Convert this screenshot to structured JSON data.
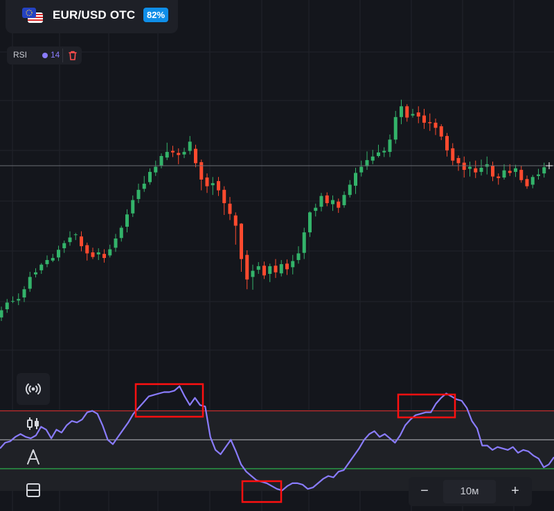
{
  "asset": {
    "name": "EUR/USD OTC",
    "payout": "82%"
  },
  "indicator": {
    "name": "RSI",
    "period": "14",
    "color": "#8a7cff"
  },
  "tools": [
    "signals-icon",
    "candles-icon",
    "drawing-tools-icon",
    "layout-icon"
  ],
  "zoom": {
    "minus": "−",
    "timeframe": "10м",
    "plus": "+"
  },
  "colors": {
    "bull": "#33b36a",
    "bear": "#ff4a2e",
    "rsi_line": "#8a7cff",
    "overbought": "#e02a2a",
    "oversold": "#2fd457",
    "highlight": "#ff1010"
  },
  "chart_data": [
    {
      "type": "candlestick",
      "title": "",
      "candles": [
        [
          0.3,
          0.44,
          0.23,
          0.51
        ],
        [
          0.46,
          0.59,
          0.39,
          0.66
        ],
        [
          0.61,
          0.62,
          0.58,
          0.71
        ],
        [
          0.63,
          0.66,
          0.54,
          0.77
        ],
        [
          0.69,
          0.85,
          0.6,
          0.91
        ],
        [
          0.86,
          1.09,
          0.8,
          1.19
        ],
        [
          1.14,
          1.18,
          1.08,
          1.26
        ],
        [
          1.22,
          1.33,
          1.15,
          1.36
        ],
        [
          1.34,
          1.42,
          1.28,
          1.51
        ],
        [
          1.41,
          1.46,
          1.38,
          1.54
        ],
        [
          1.47,
          1.62,
          1.4,
          1.7
        ],
        [
          1.65,
          1.75,
          1.56,
          1.8
        ],
        [
          1.77,
          1.86,
          1.7,
          1.98
        ],
        [
          1.91,
          1.92,
          1.81,
          1.95
        ],
        [
          1.88,
          1.69,
          1.59,
          1.98
        ],
        [
          1.71,
          1.55,
          1.41,
          1.76
        ],
        [
          1.57,
          1.48,
          1.44,
          1.66
        ],
        [
          1.53,
          1.57,
          1.42,
          1.65
        ],
        [
          1.54,
          1.46,
          1.37,
          1.63
        ],
        [
          1.51,
          1.63,
          1.47,
          1.72
        ],
        [
          1.66,
          1.84,
          1.58,
          1.93
        ],
        [
          1.85,
          2.05,
          1.78,
          2.09
        ],
        [
          2.07,
          2.31,
          1.96,
          2.41
        ],
        [
          2.33,
          2.59,
          2.26,
          2.68
        ],
        [
          2.61,
          2.79,
          2.53,
          2.91
        ],
        [
          2.81,
          2.91,
          2.75,
          3.06
        ],
        [
          2.94,
          3.14,
          2.89,
          3.21
        ],
        [
          3.13,
          3.24,
          3.06,
          3.36
        ],
        [
          3.26,
          3.45,
          3.21,
          3.5
        ],
        [
          3.42,
          3.53,
          3.37,
          3.71
        ],
        [
          3.55,
          3.52,
          3.43,
          3.65
        ],
        [
          3.51,
          3.47,
          3.29,
          3.6
        ],
        [
          3.48,
          3.53,
          3.41,
          3.61
        ],
        [
          3.55,
          3.73,
          3.48,
          3.84
        ],
        [
          3.59,
          3.31,
          3.23,
          3.67
        ],
        [
          3.33,
          2.99,
          2.78,
          3.38
        ],
        [
          3.03,
          2.86,
          2.73,
          3.11
        ],
        [
          2.88,
          2.92,
          2.69,
          3.04
        ],
        [
          2.96,
          2.78,
          2.67,
          3.04
        ],
        [
          2.79,
          2.53,
          2.3,
          2.86
        ],
        [
          2.52,
          2.32,
          2.2,
          2.65
        ],
        [
          2.29,
          2.09,
          1.72,
          2.35
        ],
        [
          2.13,
          1.44,
          1.19,
          2.14
        ],
        [
          1.52,
          1.04,
          0.85,
          1.61
        ],
        [
          1.09,
          1.21,
          0.84,
          1.33
        ],
        [
          1.23,
          1.3,
          1.15,
          1.38
        ],
        [
          1.31,
          1.12,
          1.05,
          1.39
        ],
        [
          1.15,
          1.3,
          0.99,
          1.35
        ],
        [
          1.31,
          1.18,
          1.07,
          1.44
        ],
        [
          1.16,
          1.34,
          1.1,
          1.42
        ],
        [
          1.35,
          1.24,
          1.13,
          1.43
        ],
        [
          1.28,
          1.4,
          1.14,
          1.52
        ],
        [
          1.42,
          1.55,
          1.35,
          1.69
        ],
        [
          1.56,
          1.96,
          1.44,
          2.05
        ],
        [
          1.96,
          2.35,
          1.87,
          2.37
        ],
        [
          2.38,
          2.44,
          2.27,
          2.52
        ],
        [
          2.46,
          2.67,
          2.37,
          2.73
        ],
        [
          2.68,
          2.53,
          2.47,
          2.74
        ],
        [
          2.51,
          2.59,
          2.38,
          2.68
        ],
        [
          2.56,
          2.44,
          2.34,
          2.62
        ],
        [
          2.49,
          2.69,
          2.44,
          2.76
        ],
        [
          2.69,
          2.89,
          2.64,
          2.98
        ],
        [
          2.87,
          3.12,
          2.71,
          3.22
        ],
        [
          3.13,
          3.24,
          3.05,
          3.36
        ],
        [
          3.25,
          3.37,
          3.18,
          3.54
        ],
        [
          3.36,
          3.44,
          3.29,
          3.57
        ],
        [
          3.45,
          3.52,
          3.42,
          3.67
        ],
        [
          3.52,
          3.55,
          3.43,
          3.62
        ],
        [
          3.53,
          3.77,
          3.43,
          3.87
        ],
        [
          3.77,
          4.21,
          3.69,
          4.33
        ],
        [
          4.21,
          4.42,
          4.07,
          4.55
        ],
        [
          4.42,
          4.2,
          4.12,
          4.46
        ],
        [
          4.24,
          4.27,
          4.2,
          4.37
        ],
        [
          4.3,
          4.22,
          4.09,
          4.42
        ],
        [
          4.24,
          4.1,
          3.98,
          4.37
        ],
        [
          4.11,
          4.09,
          3.94,
          4.28
        ],
        [
          4.1,
          4.0,
          3.86,
          4.18
        ],
        [
          4.03,
          3.83,
          3.76,
          4.07
        ],
        [
          3.84,
          3.56,
          3.44,
          3.9
        ],
        [
          3.6,
          3.36,
          3.27,
          3.7
        ],
        [
          3.41,
          3.31,
          3.16,
          3.46
        ],
        [
          3.32,
          3.18,
          3.03,
          3.44
        ],
        [
          3.2,
          3.24,
          3.05,
          3.34
        ],
        [
          3.21,
          3.13,
          3.02,
          3.36
        ],
        [
          3.14,
          3.22,
          3.07,
          3.38
        ],
        [
          3.24,
          3.29,
          3.09,
          3.44
        ],
        [
          3.26,
          3.05,
          2.96,
          3.34
        ],
        [
          3.05,
          3.02,
          2.89,
          3.11
        ],
        [
          3.03,
          3.17,
          2.99,
          3.29
        ],
        [
          3.16,
          3.12,
          3.06,
          3.29
        ],
        [
          3.14,
          3.21,
          3.04,
          3.28
        ],
        [
          3.18,
          2.98,
          2.93,
          3.26
        ],
        [
          3.0,
          2.86,
          2.81,
          3.07
        ],
        [
          2.89,
          3.04,
          2.82,
          3.08
        ],
        [
          3.06,
          3.09,
          2.99,
          3.2
        ],
        [
          3.11,
          3.23,
          3.03,
          3.32
        ]
      ],
      "price_line": 3.26,
      "range": [
        0,
        4.6
      ]
    },
    {
      "type": "line",
      "title": "",
      "series": [
        {
          "name": "RSI",
          "values": [
            44,
            48,
            49,
            52,
            54,
            52,
            51,
            53,
            59,
            57,
            51,
            57,
            55,
            60,
            63,
            62,
            64,
            69,
            70,
            68,
            60,
            50,
            47,
            52,
            57,
            62,
            68,
            72,
            76,
            80,
            81,
            82,
            83,
            83,
            84,
            87,
            80,
            74,
            79,
            74,
            73,
            52,
            43,
            40,
            45,
            50,
            42,
            33,
            28,
            25,
            22,
            21,
            20,
            18,
            16,
            15,
            18,
            20,
            20,
            19,
            16,
            17,
            20,
            23,
            25,
            24,
            28,
            29,
            34,
            39,
            44,
            50,
            54,
            56,
            52,
            54,
            51,
            48,
            53,
            60,
            64,
            67,
            68,
            69,
            69,
            75,
            79,
            82,
            80,
            78,
            77,
            72,
            63,
            58,
            46,
            46,
            43,
            45,
            44,
            43,
            45,
            41,
            43,
            42,
            39,
            37,
            31,
            33,
            38
          ]
        }
      ],
      "levels": [
        70,
        50,
        30
      ],
      "ylim": [
        0,
        100
      ]
    }
  ]
}
